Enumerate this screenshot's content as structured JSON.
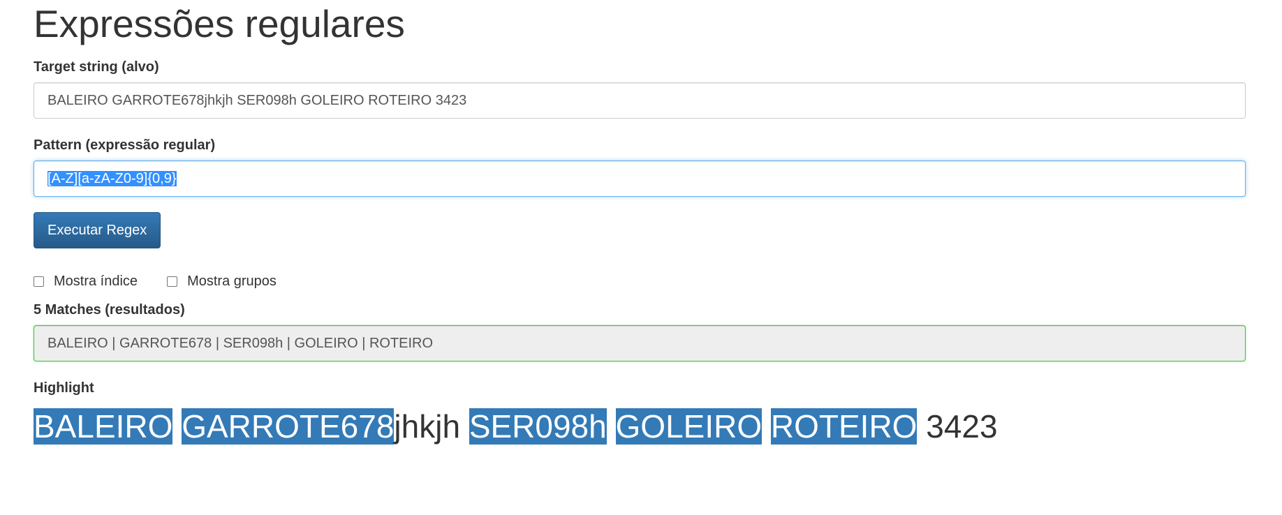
{
  "page": {
    "title": "Expressões regulares"
  },
  "target": {
    "label": "Target string (alvo)",
    "value": "BALEIRO GARROTE678jhkjh SER098h GOLEIRO ROTEIRO 3423"
  },
  "pattern": {
    "label": "Pattern (expressão regular)",
    "value": "[A-Z][a-zA-Z0-9]{0,9}"
  },
  "actions": {
    "execute_label": "Executar Regex"
  },
  "options": {
    "show_index_label": "Mostra índice",
    "show_groups_label": "Mostra grupos",
    "show_index_checked": false,
    "show_groups_checked": false
  },
  "results": {
    "label": "5 Matches (resultados)",
    "value": "BALEIRO | GARROTE678 | SER098h | GOLEIRO | ROTEIRO"
  },
  "highlight": {
    "label": "Highlight",
    "segments": [
      {
        "text": "BALEIRO",
        "match": true
      },
      {
        "text": " ",
        "match": false
      },
      {
        "text": "GARROTE678",
        "match": true
      },
      {
        "text": "jhkjh ",
        "match": false
      },
      {
        "text": "SER098h",
        "match": true
      },
      {
        "text": " ",
        "match": false
      },
      {
        "text": "GOLEIRO",
        "match": true
      },
      {
        "text": " ",
        "match": false
      },
      {
        "text": "ROTEIRO",
        "match": true
      },
      {
        "text": " 3423",
        "match": false
      }
    ]
  },
  "colors": {
    "primary": "#337ab7",
    "focus_border": "#66afe9",
    "success_border": "#33cc33",
    "selection": "#3390ff"
  }
}
